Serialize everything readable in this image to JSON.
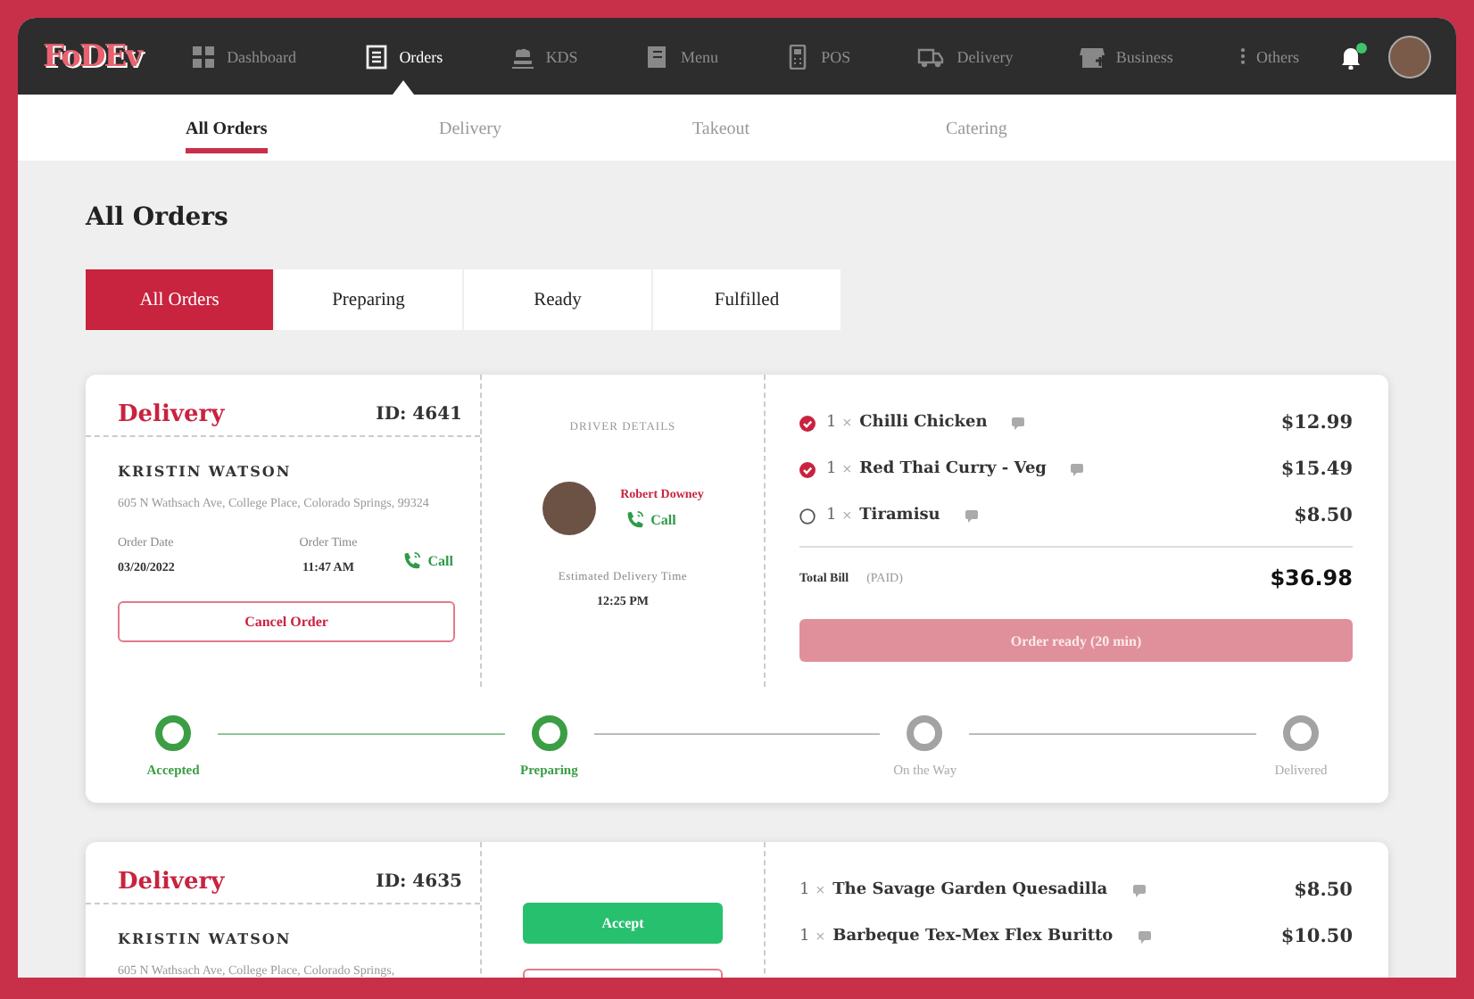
{
  "nav": {
    "logo": "FoDEv",
    "items": [
      {
        "kind": "grid",
        "label": "Dashboard",
        "selected": false
      },
      {
        "kind": "doc",
        "label": "Orders",
        "selected": true
      },
      {
        "kind": "chef",
        "label": "KDS",
        "selected": false
      },
      {
        "kind": "book",
        "label": "Menu",
        "selected": false
      },
      {
        "kind": "pos",
        "label": "POS",
        "selected": false
      },
      {
        "kind": "truck",
        "label": "Delivery",
        "selected": false
      },
      {
        "kind": "store",
        "label": "Business",
        "selected": false
      },
      {
        "kind": "dots",
        "label": "Others",
        "selected": false
      }
    ],
    "notification": true
  },
  "sub_tabs": [
    {
      "label": "All Orders",
      "selected": true
    },
    {
      "label": "Delivery",
      "selected": false
    },
    {
      "label": "Takeout",
      "selected": false
    },
    {
      "label": "Catering",
      "selected": false
    }
  ],
  "page_title": "All Orders",
  "filters": [
    {
      "label": "All Orders",
      "selected": true
    },
    {
      "label": "Preparing",
      "selected": false
    },
    {
      "label": "Ready",
      "selected": false
    },
    {
      "label": "Fulfilled",
      "selected": false
    }
  ],
  "orders": [
    {
      "type": "Delivery",
      "id": "ID: 4641",
      "customer": "KRISTIN WATSON",
      "address": "605 N Wathsach Ave, College Place, Colorado Springs, 99324",
      "order_date_label": "Order Date",
      "order_date": "03/20/2022",
      "order_time_label": "Order Time",
      "order_time": "11:47 AM",
      "call": "Call",
      "actions": [
        {
          "kind": "outline",
          "label": "Cancel Order"
        }
      ],
      "driver": {
        "heading": "DRIVER DETAILS",
        "name": "Robert Downey",
        "call": "Call",
        "eta_label": "Estimated Delivery Time",
        "eta": "12:25 PM"
      },
      "items": [
        {
          "qty": "1",
          "times": "×",
          "name": "Chilli Chicken",
          "price": "$12.99",
          "checked": true
        },
        {
          "qty": "1",
          "times": "×",
          "name": "Red Thai Curry - Veg",
          "price": "$15.49",
          "checked": true
        },
        {
          "qty": "1",
          "times": "×",
          "name": "Tiramisu",
          "price": "$8.50",
          "checked": false
        }
      ],
      "total": {
        "label": "Total Bill",
        "note": "(PAID)",
        "amount": "$36.98"
      },
      "ready_button": {
        "label": "Order ready (20 min)",
        "disabled": true
      },
      "steps": [
        {
          "label": "Accepted",
          "done": true
        },
        {
          "label": "Preparing",
          "done": true
        },
        {
          "label": "On the Way",
          "done": false
        },
        {
          "label": "Delivered",
          "done": false
        }
      ]
    },
    {
      "type": "Delivery",
      "id": "ID: 4635",
      "customer": "KRISTIN WATSON",
      "address": "605 N Wathsach Ave, College Place, Colorado Springs,",
      "actions": [
        {
          "kind": "solid",
          "label": "Accept"
        },
        {
          "kind": "outline"
        }
      ],
      "items": [
        {
          "qty": "1",
          "times": "×",
          "name": "The Savage Garden Quesadilla",
          "price": "$8.50"
        },
        {
          "qty": "1",
          "times": "×",
          "name": "Barbeque Tex-Mex Flex Buritto",
          "price": "$10.50"
        }
      ]
    }
  ]
}
